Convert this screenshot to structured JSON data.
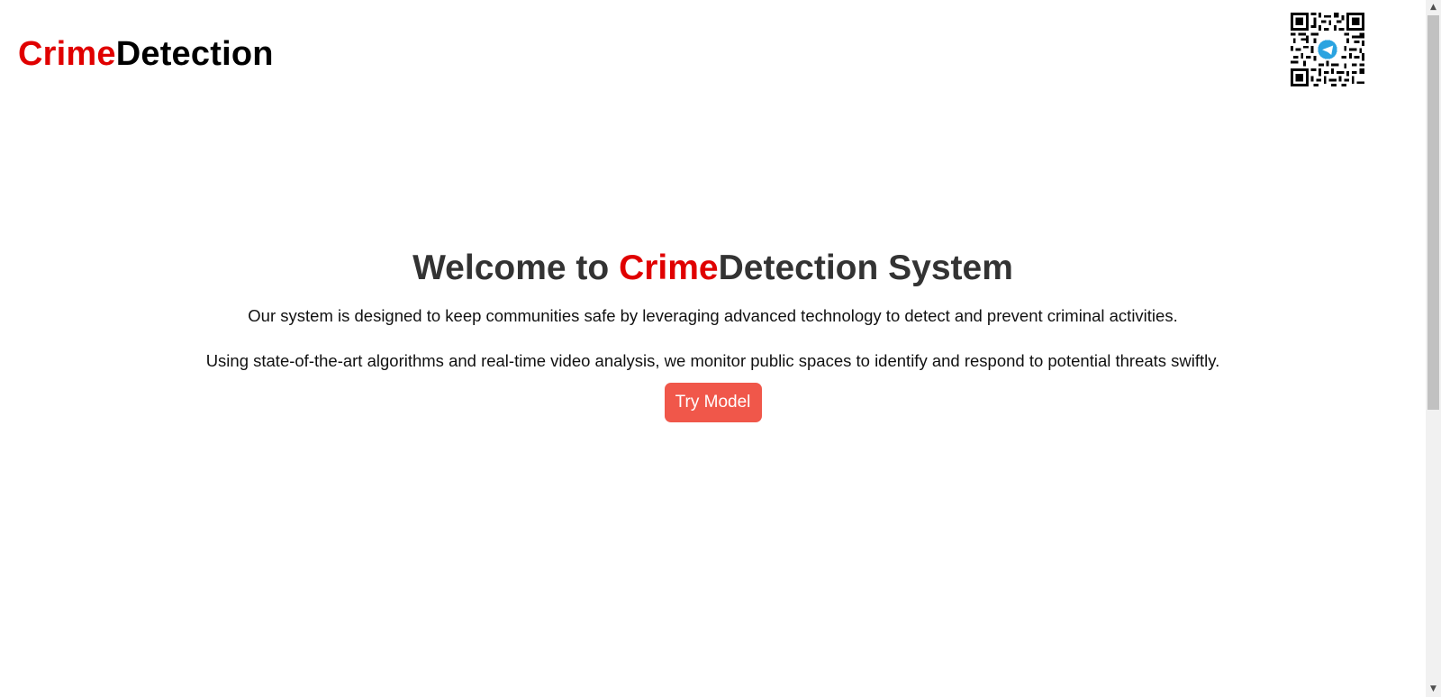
{
  "header": {
    "logo_accent": "Crime",
    "logo_rest": "Detection",
    "qr_icon": "telegram-qr-code"
  },
  "hero": {
    "title_prefix": "Welcome to ",
    "title_accent": "Crime",
    "title_suffix": "Detection System",
    "paragraph_1": "Our system is designed to keep communities safe by leveraging advanced technology to detect and prevent criminal activities.",
    "paragraph_2": "Using state-of-the-art algorithms and real-time video analysis, we monitor public spaces to identify and respond to potential threats swiftly.",
    "button_label": "Try Model"
  },
  "colors": {
    "accent_red": "#e00000",
    "button_bg": "#f0574a",
    "heading_text": "#333333",
    "telegram_blue": "#2aa3e0"
  }
}
